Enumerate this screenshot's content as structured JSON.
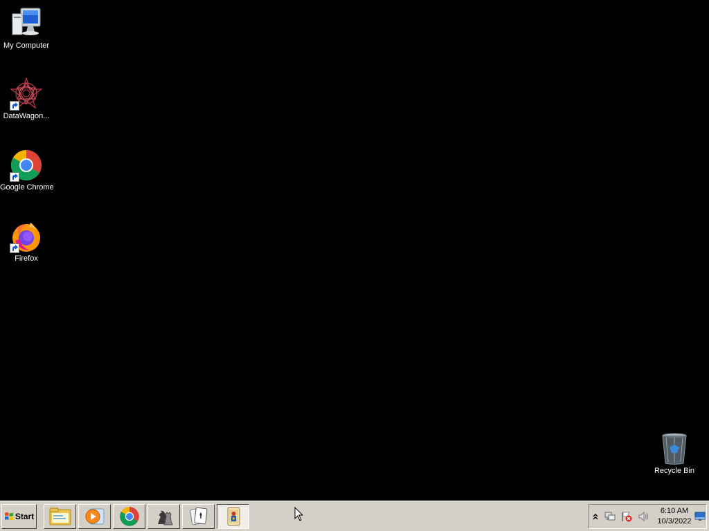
{
  "desktop": {
    "background": "#000000",
    "icons": [
      {
        "label": "My Computer",
        "icon": "computer-icon"
      },
      {
        "label": "DataWagon...",
        "icon": "datawagon-icon"
      },
      {
        "label": "Google Chrome",
        "icon": "chrome-icon"
      },
      {
        "label": "Firefox",
        "icon": "firefox-icon"
      },
      {
        "label": "Recycle Bin",
        "icon": "recycle-bin-icon"
      }
    ]
  },
  "taskbar": {
    "start_label": "Start",
    "pinned": [
      {
        "icon": "file-explorer-icon"
      },
      {
        "icon": "media-player-icon"
      },
      {
        "icon": "chrome-icon"
      },
      {
        "icon": "chess-icon"
      },
      {
        "icon": "solitaire-icon"
      },
      {
        "icon": "card-game-icon",
        "active": true
      }
    ],
    "tray": {
      "icons": [
        "show-hidden-icons-icon",
        "network-icon",
        "action-center-icon",
        "volume-icon",
        "show-desktop-icon"
      ],
      "time": "6:10 AM",
      "date": "10/3/2022"
    }
  },
  "colors": {
    "taskbar": "#d4d0c8",
    "label_text": "#ffffff"
  }
}
